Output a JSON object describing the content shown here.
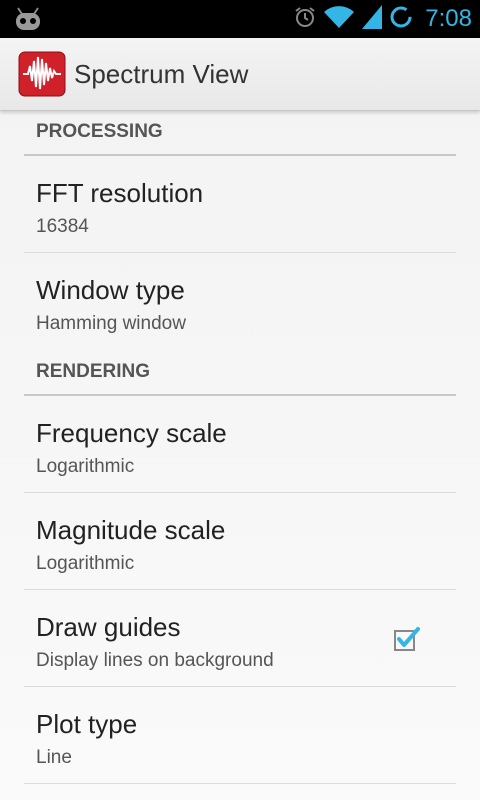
{
  "status_bar": {
    "time": "7:08",
    "icons": [
      "android-robot-icon",
      "alarm-icon",
      "wifi-icon",
      "signal-icon",
      "battery-charging-icon"
    ]
  },
  "action_bar": {
    "title": "Spectrum View",
    "icon": "waveform-icon"
  },
  "sections": [
    {
      "header": "PROCESSING",
      "items": [
        {
          "title": "FFT resolution",
          "summary": "16384"
        },
        {
          "title": "Window type",
          "summary": "Hamming window"
        }
      ]
    },
    {
      "header": "RENDERING",
      "items": [
        {
          "title": "Frequency scale",
          "summary": "Logarithmic"
        },
        {
          "title": "Magnitude scale",
          "summary": "Logarithmic"
        },
        {
          "title": "Draw guides",
          "summary": "Display lines on background",
          "checked": true
        },
        {
          "title": "Plot type",
          "summary": "Line"
        }
      ]
    }
  ],
  "colors": {
    "accent": "#33b5e5",
    "icon_red": "#d0202a"
  }
}
